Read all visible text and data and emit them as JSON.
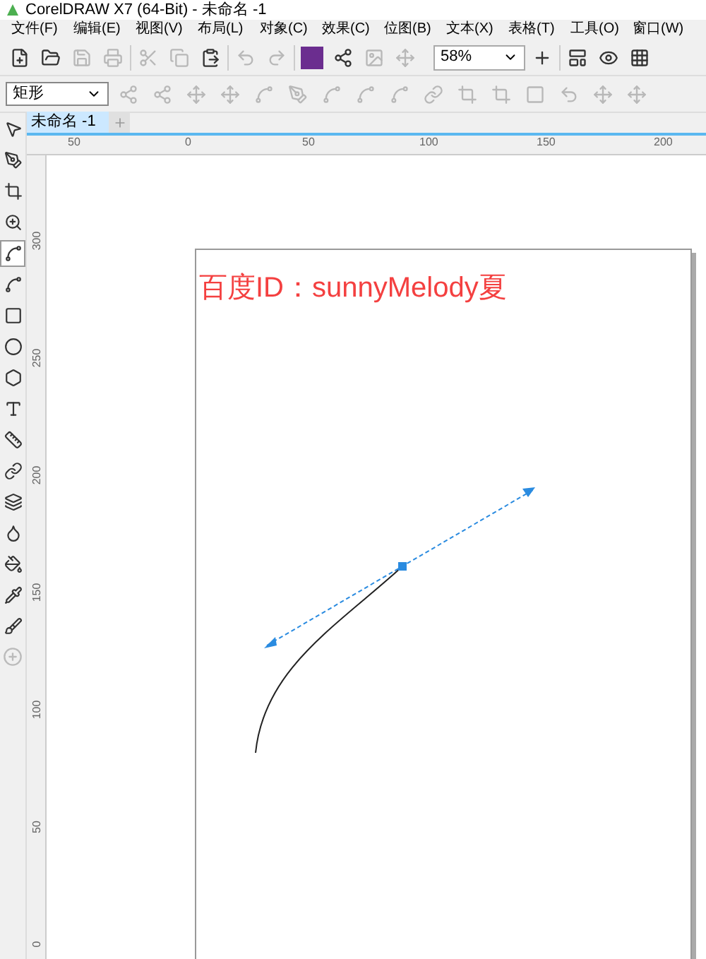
{
  "window": {
    "title": "CorelDRAW X7 (64-Bit) - 未命名 -1"
  },
  "menu": [
    "文件(F)",
    "编辑(E)",
    "视图(V)",
    "布局(L)",
    "对象(C)",
    "效果(C)",
    "位图(B)",
    "文本(X)",
    "表格(T)",
    "工具(O)",
    "窗口(W)"
  ],
  "toolbar": {
    "zoom": "58%"
  },
  "property_bar": {
    "shape_type": "矩形"
  },
  "document_tabs": [
    {
      "label": "未命名 -1",
      "selected": true
    }
  ],
  "tools": [
    {
      "selected": false
    },
    {
      "selected": false
    },
    {
      "selected": false
    },
    {
      "selected": false
    },
    {
      "selected": true
    },
    {
      "selected": false
    },
    {
      "selected": false
    },
    {
      "selected": false
    },
    {
      "selected": false
    },
    {
      "selected": false
    },
    {
      "selected": false
    },
    {
      "selected": false
    },
    {
      "selected": false
    },
    {
      "selected": false
    },
    {
      "selected": false
    },
    {
      "selected": false
    },
    {
      "selected": false
    }
  ],
  "ruler_h": [
    "50",
    "0",
    "50",
    "100",
    "150",
    "200"
  ],
  "ruler_v": [
    "300",
    "250",
    "200",
    "150",
    "100",
    "50",
    "0"
  ],
  "canvas": {
    "text": "百度ID：sunnyMelody夏"
  }
}
